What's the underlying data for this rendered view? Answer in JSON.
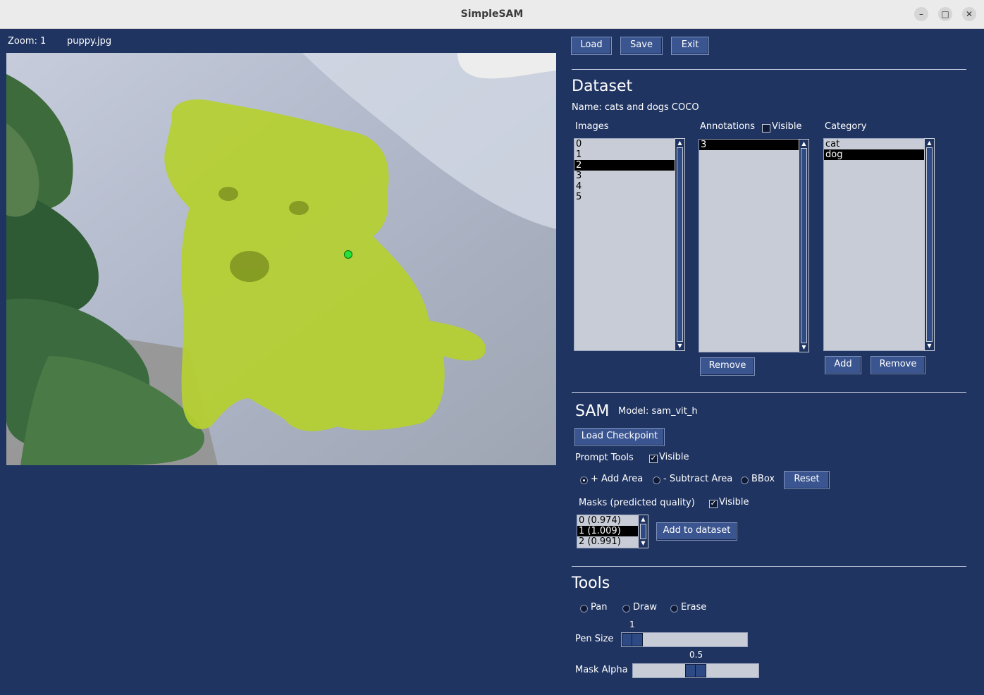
{
  "window": {
    "title": "SimpleSAM",
    "minimize": "–",
    "maximize": "□",
    "close": "✕"
  },
  "viewer": {
    "zoom_label": "Zoom: 1",
    "filename": "puppy.jpg"
  },
  "toolbar": {
    "load": "Load",
    "save": "Save",
    "exit": "Exit"
  },
  "dataset": {
    "heading": "Dataset",
    "name_label": "Name: cats and dogs COCO",
    "images_header": "Images",
    "images": [
      "0",
      "1",
      "2",
      "3",
      "4",
      "5"
    ],
    "images_selected_index": 2,
    "annotations_header": "Annotations",
    "annotations_visible_label": "Visible",
    "annotations": [
      "3"
    ],
    "annotations_selected_index": 0,
    "annotations_remove": "Remove",
    "category_header": "Category",
    "categories": [
      "cat",
      "dog"
    ],
    "category_selected_index": 1,
    "category_add": "Add",
    "category_remove": "Remove"
  },
  "sam": {
    "heading": "SAM",
    "model_label": "Model: sam_vit_h",
    "load_checkpoint": "Load Checkpoint",
    "prompt_tools_label": "Prompt Tools",
    "prompt_visible_label": "Visible",
    "add_area": "+ Add Area",
    "subtract_area": "- Subtract Area",
    "bbox": "BBox",
    "reset": "Reset",
    "masks_label": "Masks (predicted quality)",
    "masks_visible_label": "Visible",
    "masks": [
      "0 (0.974)",
      "1 (1.009)",
      "2 (0.991)"
    ],
    "masks_selected_index": 1,
    "add_to_dataset": "Add to dataset"
  },
  "tools": {
    "heading": "Tools",
    "pan": "Pan",
    "draw": "Draw",
    "erase": "Erase",
    "pen_size_label": "Pen Size",
    "pen_size_value": "1",
    "pen_size_fraction": 0.0,
    "mask_alpha_label": "Mask Alpha",
    "mask_alpha_value": "0.5",
    "mask_alpha_fraction": 0.5
  },
  "colors": {
    "background": "#1f3461",
    "mask": "#b5d02f",
    "prompt_point": "#22e33a",
    "button": "#3a5590"
  }
}
